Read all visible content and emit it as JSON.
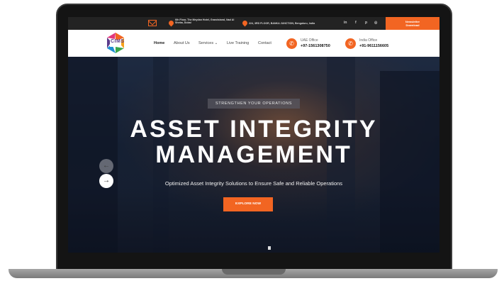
{
  "topbar": {
    "address_uae": "6th Floor, The Meydan Hotel, Grandstand, Nad Al Sheba, Dubai",
    "address_india": "224, 3RD FLOOR, BANKA JUNCTION, Bengaluru, India",
    "social_icons": [
      "linkedin-icon",
      "facebook-icon",
      "pinterest-icon",
      "instagram-icon"
    ],
    "social_glyphs": [
      "in",
      "f",
      "p",
      "◎"
    ],
    "newsletter_line1": "Newsletter",
    "newsletter_line2": "Download"
  },
  "header": {
    "logo_text": "CIMS",
    "nav": [
      "Home",
      "About Us",
      "Services ⌄",
      "Live Training",
      "Contact"
    ],
    "uae_label": "UAE Office",
    "uae_phone": "+97-1561308750",
    "india_label": "India Office",
    "india_phone": "+91-9611156605"
  },
  "hero": {
    "eyebrow": "STRENGTHEN YOUR OPERATIONS",
    "title_line1": "ASSET INTEGRITY",
    "title_line2": "MANAGEMENT",
    "subtitle": "Optimized Asset Integrity Solutions to Ensure Safe and Reliable Operations",
    "cta": "EXPLORE NOW",
    "prev_arrow": "←",
    "next_arrow": "→"
  },
  "colors": {
    "accent": "#f26522",
    "topbar": "#232323",
    "header": "#ffffff",
    "hero_overlay": "#1d2a40"
  }
}
